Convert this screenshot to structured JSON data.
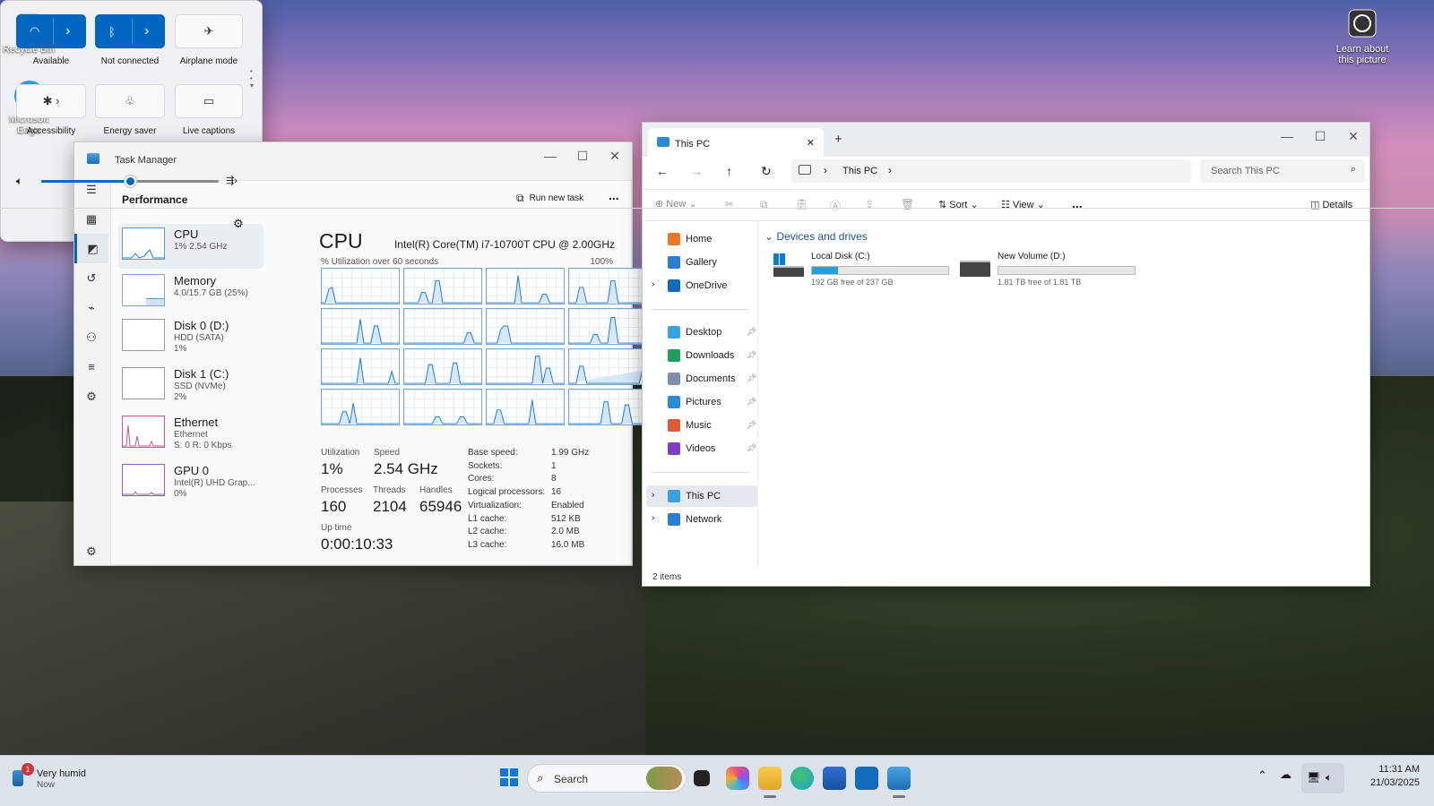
{
  "desktop": {
    "icons": [
      {
        "label": "Recycle Bin"
      },
      {
        "label": "Microsoft Edge"
      }
    ],
    "learn": "Learn about this picture"
  },
  "task_manager": {
    "title": "Task Manager",
    "section": "Performance",
    "run_new_task": "Run new task",
    "more": "...",
    "side": [
      {
        "name": "CPU",
        "line1": "1% 2.54 GHz",
        "line2": ""
      },
      {
        "name": "Memory",
        "line1": "4.0/15.7 GB (25%)",
        "line2": ""
      },
      {
        "name": "Disk 0 (D:)",
        "line1": "HDD (SATA)",
        "line2": "1%"
      },
      {
        "name": "Disk 1 (C:)",
        "line1": "SSD (NVMe)",
        "line2": "2%"
      },
      {
        "name": "Ethernet",
        "line1": "Ethernet",
        "line2": "S: 0 R: 0 Kbps"
      },
      {
        "name": "GPU 0",
        "line1": "Intel(R) UHD Grap...",
        "line2": "0%"
      }
    ],
    "cpu_title": "CPU",
    "cpu_model": "Intel(R) Core(TM) i7-10700T CPU @ 2.00GHz",
    "graph_caption": "% Utilization over 60 seconds",
    "graph_max": "100%",
    "stats": {
      "utilization_label": "Utilization",
      "utilization": "1%",
      "speed_label": "Speed",
      "speed": "2.54 GHz",
      "processes_label": "Processes",
      "processes": "160",
      "threads_label": "Threads",
      "threads": "2104",
      "handles_label": "Handles",
      "handles": "65946",
      "uptime_label": "Up time",
      "uptime": "0:00:10:33"
    },
    "details": [
      {
        "k": "Base speed:",
        "v": "1.99 GHz"
      },
      {
        "k": "Sockets:",
        "v": "1"
      },
      {
        "k": "Cores:",
        "v": "8"
      },
      {
        "k": "Logical processors:",
        "v": "16"
      },
      {
        "k": "Virtualization:",
        "v": "Enabled"
      },
      {
        "k": "L1 cache:",
        "v": "512 KB"
      },
      {
        "k": "L2 cache:",
        "v": "2.0 MB"
      },
      {
        "k": "L3 cache:",
        "v": "16.0 MB"
      }
    ]
  },
  "explorer": {
    "tab": "This PC",
    "breadcrumb": "This PC",
    "search_placeholder": "Search This PC",
    "cmd": {
      "new": "New",
      "sort": "Sort",
      "view": "View",
      "more": "...",
      "details": "Details"
    },
    "nav": [
      {
        "label": "Home",
        "color": "#e8772e"
      },
      {
        "label": "Gallery",
        "color": "#2a7fd4"
      },
      {
        "label": "OneDrive",
        "color": "#0f6cbd"
      },
      {
        "label": "Desktop",
        "color": "#3aa0e0"
      },
      {
        "label": "Downloads",
        "color": "#1e9e5a"
      },
      {
        "label": "Documents",
        "color": "#7f8fa6"
      },
      {
        "label": "Pictures",
        "color": "#2a8ad4"
      },
      {
        "label": "Music",
        "color": "#e05a3a"
      },
      {
        "label": "Videos",
        "color": "#7c3fbf"
      },
      {
        "label": "This PC",
        "color": "#3aa0e0"
      },
      {
        "label": "Network",
        "color": "#2a7fd4"
      }
    ],
    "group": "Devices and drives",
    "drives": [
      {
        "name": "Local Disk (C:)",
        "free": "192 GB free of 237 GB",
        "used_fraction": 0.19
      },
      {
        "name": "New Volume (D:)",
        "free": "1.81 TB free of 1.81 TB",
        "used_fraction": 0.0
      }
    ],
    "status": "2 items"
  },
  "quick_settings": {
    "tiles": [
      {
        "label": "Available"
      },
      {
        "label": "Not connected"
      },
      {
        "label": "Airplane mode"
      },
      {
        "label": "Accessibility"
      },
      {
        "label": "Energy saver"
      },
      {
        "label": "Live captions"
      }
    ],
    "volume_fraction": 0.5
  },
  "taskbar": {
    "weather_title": "Very humid",
    "weather_sub": "Now",
    "badge": "1",
    "search": "Search",
    "time": "11:31 AM",
    "date": "21/03/2025"
  }
}
